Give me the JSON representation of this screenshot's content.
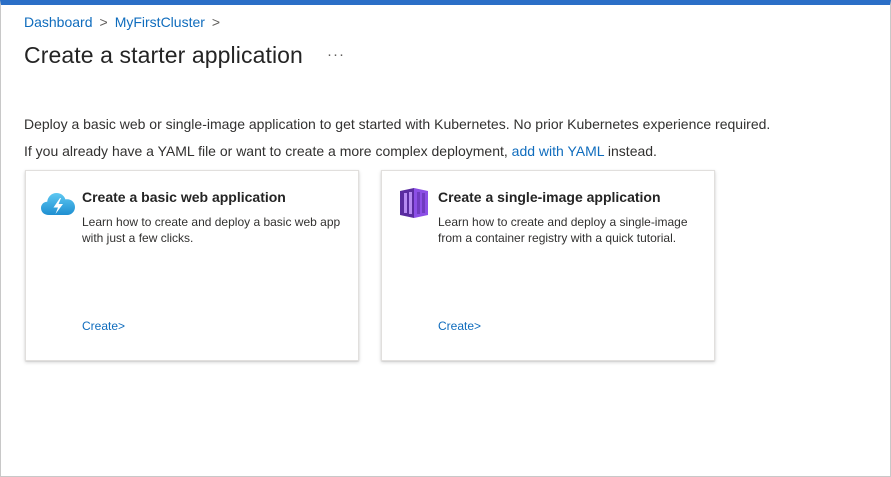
{
  "breadcrumb": {
    "items": [
      "Dashboard",
      "MyFirstCluster"
    ],
    "separator": ">"
  },
  "page": {
    "title": "Create a starter application",
    "more": "···"
  },
  "description": {
    "line1": "Deploy a basic web or single-image application to get started with Kubernetes. No prior Kubernetes experience required.",
    "line2_prefix": "If you already have a YAML file or want to create a more complex deployment, ",
    "line2_link": "add with YAML",
    "line2_suffix": " instead."
  },
  "cards": [
    {
      "title": "Create a basic web application",
      "body": "Learn how to create and deploy a basic web app with just a few clicks.",
      "link": "Create>",
      "icon": "cloud-lightning-icon"
    },
    {
      "title": "Create a single-image application",
      "body": "Learn how to create and deploy a single-image from a container registry with a quick tutorial.",
      "link": "Create>",
      "icon": "container-image-icon"
    }
  ],
  "colors": {
    "accent": "#0f6cbd",
    "top_bar": "#2b6fc7",
    "cloud": "#32a8e0",
    "container": "#773adc"
  }
}
